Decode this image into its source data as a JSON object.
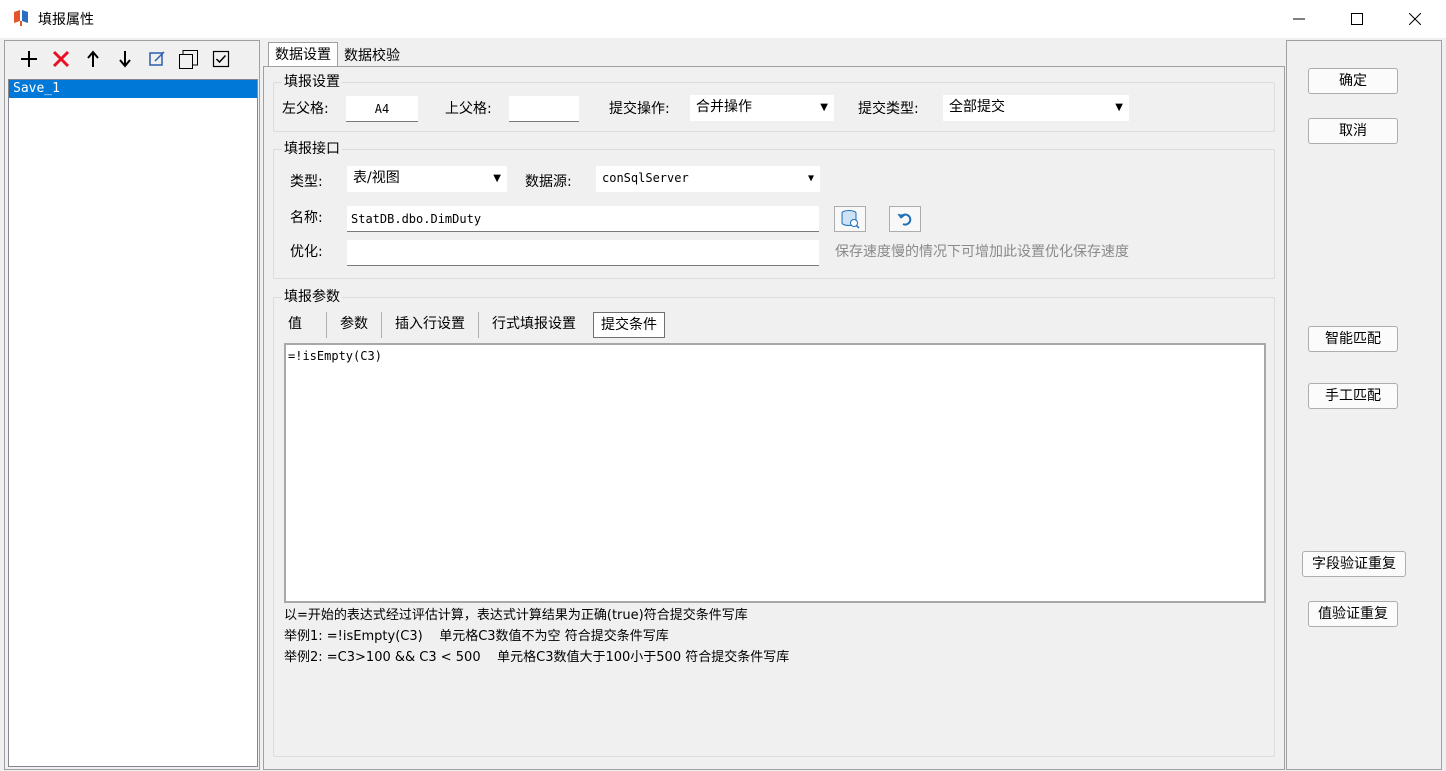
{
  "window": {
    "title": "填报属性"
  },
  "left": {
    "toolbar_icons": [
      "add-icon",
      "delete-icon",
      "move-up-icon",
      "move-down-icon",
      "edit-icon",
      "copy-icon",
      "check-icon"
    ],
    "items": [
      {
        "label": "Save_1",
        "selected": true
      }
    ]
  },
  "tabs": [
    {
      "label": "数据设置",
      "active": true
    },
    {
      "label": "数据校验",
      "active": false
    }
  ],
  "fill_settings": {
    "group_title": "填报设置",
    "left_parent_label": "左父格:",
    "left_parent_value": "A4",
    "top_parent_label": "上父格:",
    "top_parent_value": "",
    "submit_op_label": "提交操作:",
    "submit_op_value": "合并操作",
    "submit_type_label": "提交类型:",
    "submit_type_value": "全部提交"
  },
  "interface": {
    "group_title": "填报接口",
    "type_label": "类型:",
    "type_value": "表/视图",
    "datasource_label": "数据源:",
    "datasource_value": "conSqlServer",
    "name_label": "名称:",
    "name_value": "StatDB.dbo.DimDuty",
    "optimize_label": "优化:",
    "optimize_value": "",
    "optimize_hint": "保存速度慢的情况下可增加此设置优化保存速度"
  },
  "params": {
    "group_title": "填报参数",
    "tabs": [
      {
        "label": "值",
        "active": false
      },
      {
        "label": "参数",
        "active": false
      },
      {
        "label": "插入行设置",
        "active": false
      },
      {
        "label": "行式填报设置",
        "active": false
      },
      {
        "label": "提交条件",
        "active": true
      }
    ],
    "expression": "=!isEmpty(C3)",
    "help": [
      "以=开始的表达式经过评估计算，表达式计算结果为正确(true)符合提交条件写库",
      "举例1: =!isEmpty(C3)    单元格C3数值不为空 符合提交条件写库",
      "举例2: =C3>100 && C3 < 500    单元格C3数值大于100小于500 符合提交条件写库"
    ]
  },
  "buttons": {
    "ok": "确定",
    "cancel": "取消",
    "smart_match": "智能匹配",
    "manual_match": "手工匹配",
    "field_validate_dup": "字段验证重复",
    "value_validate_dup": "值验证重复"
  },
  "colors": {
    "selection": "#0078d7",
    "delete_icon": "#e81123"
  }
}
